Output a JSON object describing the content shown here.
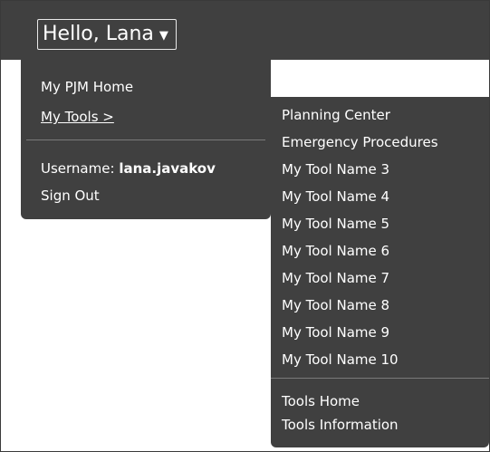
{
  "header": {
    "greeting": "Hello, Lana",
    "caret": "▼"
  },
  "user_menu": {
    "items": [
      {
        "label": "My PJM Home"
      },
      {
        "label": "My Tools >"
      }
    ],
    "username_label": "Username:",
    "username_value": "lana.javakov",
    "sign_out": "Sign Out"
  },
  "tools_menu": {
    "tools": [
      {
        "label": "Planning Center"
      },
      {
        "label": "Emergency Procedures"
      },
      {
        "label": "My Tool Name 3"
      },
      {
        "label": "My Tool Name 4"
      },
      {
        "label": "My Tool Name 5"
      },
      {
        "label": "My Tool Name 6"
      },
      {
        "label": "My Tool Name 7"
      },
      {
        "label": "My Tool Name 8"
      },
      {
        "label": "My Tool Name 9"
      },
      {
        "label": "My Tool Name 10"
      }
    ],
    "footer_links": [
      {
        "label": "Tools Home"
      },
      {
        "label": "Tools Information"
      }
    ]
  },
  "colors": {
    "menu_background": "#404040",
    "text": "#ffffff"
  }
}
